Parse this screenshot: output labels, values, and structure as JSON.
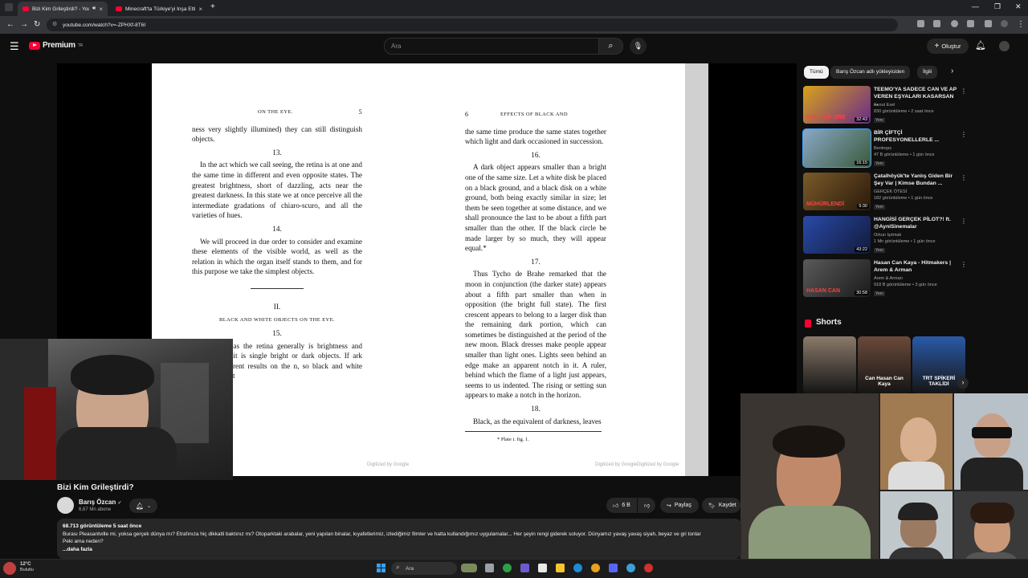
{
  "browser": {
    "tabs": [
      {
        "title": "Bizi Kim Grileştirdi? - YouTube",
        "active": true
      },
      {
        "title": "Minecraft'ta Türkiye'yi İnşa Etti…",
        "active": false
      }
    ],
    "new_tab": "+",
    "url": "youtube.com/watch?v=-ZPHXf-8T6I"
  },
  "youtube": {
    "logo_text": "Premium",
    "logo_sup": "TR",
    "search_placeholder": "Ara",
    "create_label": "Oluştur"
  },
  "book": {
    "left": {
      "running_head": "ON THE EYE.",
      "page_number": "5",
      "para_cont": "ness very slightly illumined) they can still distinguish objects.",
      "n13": "13.",
      "p13": "In the act which we call seeing, the retina is at one and the same time in different and even opposite states. The greatest brightness, short of dazzling, acts near the greatest darkness. In this state we at once perceive all the intermediate gradations of chiaro-scuro, and all the varieties of hues.",
      "n14": "14.",
      "p14": "We will proceed in due order to consider and examine these elements of the visible world, as well as the relation in which the organ itself stands to them, and for this purpose we take the simplest objects.",
      "section": "II.",
      "section_title": "BLACK AND WHITE OBJECTS ON THE EYE.",
      "n15": "15.",
      "p15": "e manner as the retina generally is brightness and darkness, so it is single bright or dark objects. If ark produce different results on the n, so black and white objects seen at",
      "digitized": "Digitized by Google"
    },
    "right": {
      "page_number": "6",
      "running_head": "EFFECTS OF BLACK AND",
      "para_cont": "the same time produce the same states together which light and dark occasioned in succession.",
      "n16": "16.",
      "p16": "A dark object appears smaller than a bright one of the same size. Let a white disk be placed on a black ground, and a black disk on a white ground, both being exactly similar in size; let them be seen together at some distance, and we shall pronounce the last to be about a fifth part smaller than the other. If the black circle be made larger by so much, they will appear equal.*",
      "n17": "17.",
      "p17": "Thus Tycho de Brahe remarked that the moon in conjunction (the darker state) appears about a fifth part smaller than when in opposition (the bright full state). The first crescent appears to belong to a larger disk than the remaining dark portion, which can sometimes be distinguished at the period of the new moon. Black dresses make people appear smaller than light ones. Lights seen behind an edge make an apparent notch in it. A ruler, behind which the flame of a light just appears, seems to us indented. The rising or setting sun appears to make a notch in the horizon.",
      "n18": "18.",
      "p18": "Black, as the equivalent of darkness, leaves",
      "footnote": "* Plate i. fig. 1.",
      "digitized_a": "Digitized by Google",
      "digitized_b": "Digitized by Google"
    }
  },
  "video": {
    "title": "Bizi Kim Grileştirdi?",
    "channel": "Barış Özcan",
    "verified": "✔",
    "subscribers": "6,67 Mn abone",
    "likes": "6 B",
    "share": "Paylaş",
    "save": "Kaydet",
    "views_time": "68.713 görüntüleme  5 saat önce",
    "description": "Burası Pleasantville mi, yoksa gerçek dünya mı? Etrafınıza hiç dikkatli baktınız mı? Otoparktaki arabalar, yeni yapılan binalar, kıyafetlerimiz, izlediğimiz filmler ve hatta kullandığımız uygulamalar... Her şeyin rengi giderek soluyor. Dünyamız yavaş yavaş siyah, beyaz ve gri tonlar",
    "description_2": "Peki ama neden?",
    "more": "...daha fazla"
  },
  "sidebar": {
    "chips": [
      "Tümü",
      "Barış Özcan adlı yükleyiciden",
      "İlgili"
    ],
    "recommendations": [
      {
        "title": "TEEMO'YA SADECE CAN VE AP VEREN EŞYALARI KASARSAN ...",
        "channel": "Scout Exel",
        "meta": "830 görüntüleme • 2 saat önce",
        "badge": "Yeni",
        "duration": "32:43",
        "overlay": "SOK TOP ORE",
        "color_a": "#d8a21a",
        "color_b": "#6a2a8a"
      },
      {
        "title": "BİR ÇİFTÇİ PROFESYONELLERLE ...",
        "channel": "Bentrops",
        "meta": "47 B görüntüleme • 1 gün önce",
        "badge": "Yeni",
        "duration": "16:15",
        "overlay": "",
        "color_a": "#8aa8c8",
        "color_b": "#3a5a3a"
      },
      {
        "title": "Çatalhöyük'te Yanlış Giden Bir Şey Var | Kimse Bundan ...",
        "channel": "GERÇEK ÖTESİ",
        "meta": "182 görüntüleme • 1 gün önce",
        "badge": "Yeni",
        "duration": "9:30",
        "overlay": "MÜHÜRLENDİ",
        "color_a": "#7a5a2a",
        "color_b": "#2a1a0a"
      },
      {
        "title": "HANGİSİ GERÇEK PİLOT?! ft. @AyniSinemalar",
        "channel": "Orkun Işıtmak",
        "meta": "1 Mn görüntüleme • 1 gün önce",
        "badge": "Yeni",
        "duration": "43:22",
        "overlay": "",
        "color_a": "#2a4aa8",
        "color_b": "#111a3a"
      },
      {
        "title": "Hasan Can Kaya - Hitmakers | Arem & Arman",
        "channel": "Arem & Arman",
        "meta": "918 B görüntüleme • 3 gün önce",
        "badge": "Yeni",
        "duration": "30:58",
        "overlay": "HASAN CAN",
        "color_a": "#5a5a5a",
        "color_b": "#1a1a1a"
      }
    ],
    "shorts_title": "Shorts",
    "shorts": [
      {
        "overlay": "",
        "color_a": "#8a7a6a"
      },
      {
        "overlay": "Can Hasan Can Kaya",
        "color_a": "#6a4a3a"
      },
      {
        "overlay": "TRT SPİKERİ TAKLİDİ",
        "color_a": "#2a5aa8"
      }
    ]
  },
  "taskbar": {
    "temperature": "12°C",
    "weather": "Bulutlu",
    "search": "Ara"
  }
}
